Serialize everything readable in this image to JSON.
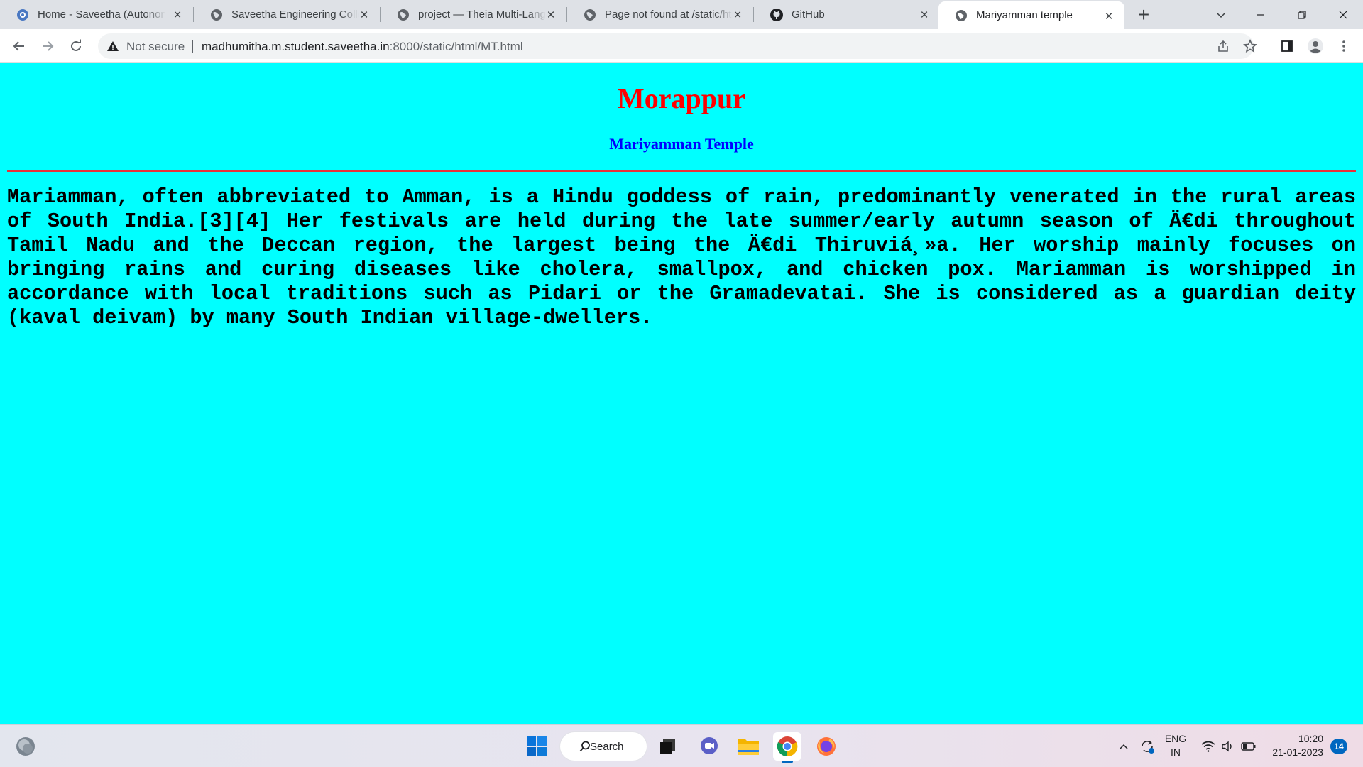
{
  "browser": {
    "tabs": [
      {
        "title": "Home - Saveetha (Autonomous)",
        "favicon": "saveetha-icon"
      },
      {
        "title": "Saveetha Engineering College",
        "favicon": "globe-icon"
      },
      {
        "title": "project — Theia Multi-Language",
        "favicon": "globe-icon"
      },
      {
        "title": "Page not found at /static/html",
        "favicon": "globe-icon"
      },
      {
        "title": "GitHub",
        "favicon": "github-icon"
      },
      {
        "title": "Mariyamman temple",
        "favicon": "globe-icon",
        "active": true
      }
    ],
    "security_label": "Not secure",
    "url_host": "madhumitha.m.student.saveetha.in",
    "url_path": ":8000/static/html/MT.html"
  },
  "page": {
    "background_color": "#00ffff",
    "heading": "Morappur",
    "heading_color": "#ff0000",
    "subheading": "Mariyamman Temple",
    "subheading_color": "#0000ff",
    "body_text": "Mariamman, often abbreviated to Amman, is a Hindu goddess of rain, predominantly venerated in the rural areas of South India.[3][4] Her festivals are held during the late summer/early autumn season of Ä€di throughout Tamil Nadu and the Deccan region, the largest being the Ä€di Thiruviá¸»a. Her worship mainly focuses on bringing rains and curing diseases like cholera, smallpox, and chicken pox. Mariamman is worshipped in accordance with local traditions such as Pidari or the Gramadevatai. She is considered as a guardian deity (kaval deivam) by many South Indian village-dwellers."
  },
  "taskbar": {
    "search_label": "Search",
    "language": "ENG",
    "region": "IN",
    "time": "10:20",
    "date": "21-01-2023",
    "notification_count": "14",
    "pinned": [
      "windows-start-icon",
      "search-icon",
      "task-view-icon",
      "teams-chat-icon",
      "file-explorer-icon",
      "chrome-icon",
      "firefox-icon"
    ]
  }
}
